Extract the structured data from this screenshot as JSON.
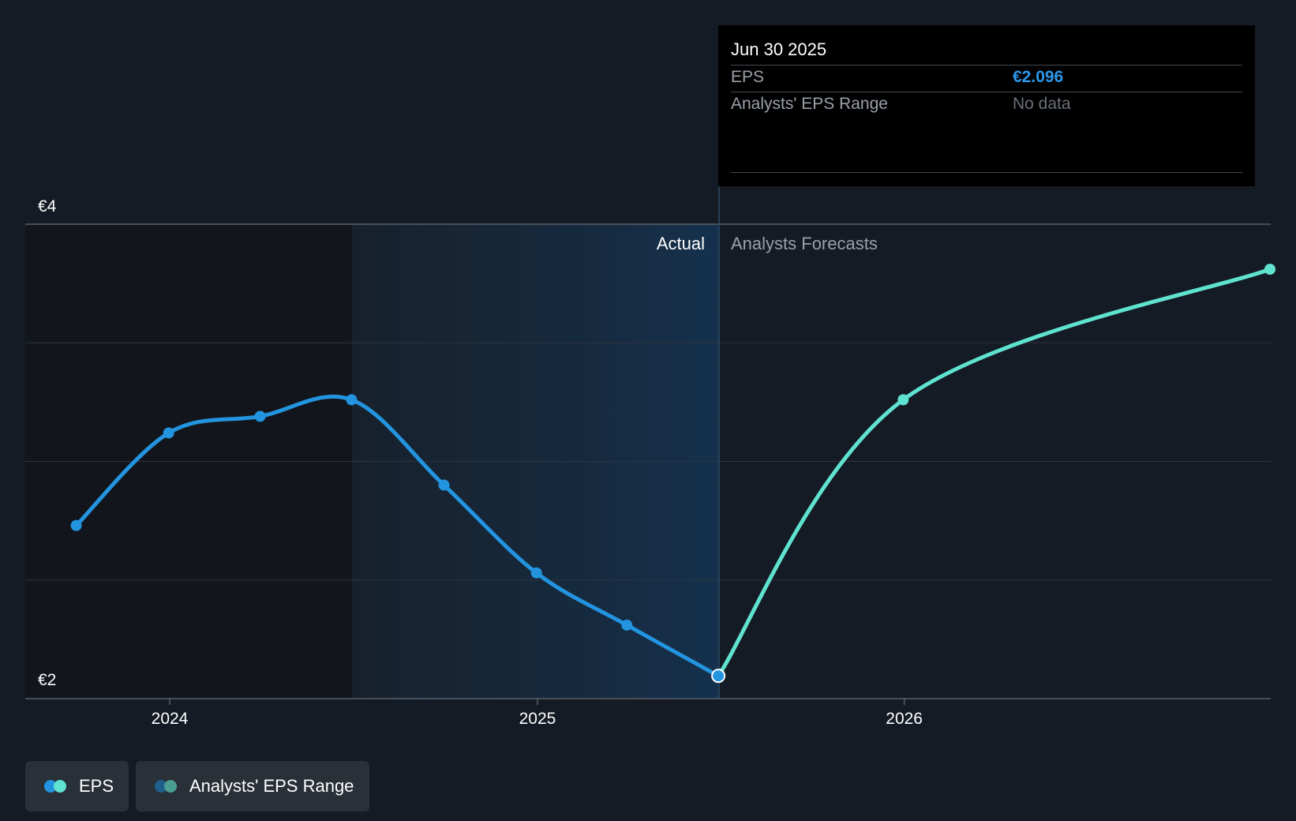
{
  "chart_data": {
    "type": "line",
    "x_ticks": [
      "2024",
      "2025",
      "2026"
    ],
    "y_ticks": [
      "€2",
      "€4"
    ],
    "ylim": [
      2,
      4
    ],
    "section_labels": {
      "actual": "Actual",
      "forecast": "Analysts Forecasts"
    },
    "series": [
      {
        "name": "EPS",
        "kind": "actual",
        "points": [
          {
            "x": "2023-09-30",
            "y": 2.73
          },
          {
            "x": "2023-12-31",
            "y": 3.12
          },
          {
            "x": "2024-03-31",
            "y": 3.19
          },
          {
            "x": "2024-06-30",
            "y": 3.26
          },
          {
            "x": "2024-09-30",
            "y": 2.9
          },
          {
            "x": "2024-12-31",
            "y": 2.53
          },
          {
            "x": "2025-03-31",
            "y": 2.31
          },
          {
            "x": "2025-06-30",
            "y": 2.096
          }
        ]
      },
      {
        "name": "EPS",
        "kind": "forecast",
        "points": [
          {
            "x": "2025-06-30",
            "y": 2.096
          },
          {
            "x": "2025-12-31",
            "y": 3.26
          },
          {
            "x": "2026-12-31",
            "y": 3.81
          }
        ]
      }
    ],
    "tooltip": {
      "date": "Jun 30 2025",
      "rows": [
        {
          "label": "EPS",
          "value": "€2.096"
        },
        {
          "label": "Analysts' EPS Range",
          "value": "No data"
        }
      ]
    },
    "legend": [
      "EPS",
      "Analysts' EPS Range"
    ],
    "colors": {
      "actual": "#2394df",
      "forecast": "#5fe3d0",
      "range_actual": "#1f5f8b",
      "range_forecast": "#4a9e92",
      "tooltip_eps": "#2d98e8",
      "tooltip_nodata": "#6a7078"
    }
  }
}
